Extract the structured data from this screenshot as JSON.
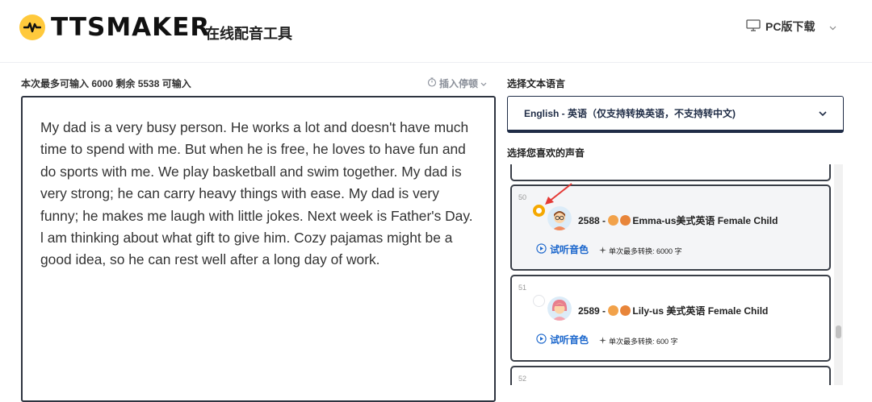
{
  "header": {
    "brand": "TTSMAKER",
    "subtitle": "在线配音工具",
    "pc_download": "PC版下载"
  },
  "editor": {
    "limit_label": "本次最多可输入 6000 剩余 5538 可输入",
    "insert_pause": "插入停顿",
    "text": "My dad is a very busy person. He works a lot and doesn't have much time to spend with me. But when he is free, he loves to have fun and do sports with me. We play basketball and swim together. My dad is very strong; he can carry heavy things with ease. My dad is very funny; he makes me laugh with little jokes. Next week is Father's Day. l am thinking about what gift to give him. Cozy pajamas might be a good idea, so he can rest well after a long day of work."
  },
  "language": {
    "title": "选择文本语言",
    "selected": "English - 英语（仅支持转换英语，不支持转中文)"
  },
  "voices": {
    "title": "选择您喜欢的声音",
    "items": [
      {
        "index": "50",
        "id_prefix": "2588 - ",
        "name": "Emma-us美式英语 Female Child",
        "listen": "试听音色",
        "limit": "单次最多转换: 6000 字",
        "selected": true
      },
      {
        "index": "51",
        "id_prefix": "2589 - ",
        "name": "Lily-us 美式英语 Female Child",
        "listen": "试听音色",
        "limit": "单次最多转换: 600 字",
        "selected": false
      },
      {
        "index": "52"
      }
    ]
  },
  "colors": {
    "accent": "#ffc93c",
    "radio_selected": "#f5a800",
    "link": "#1a66cc",
    "annotation_arrow": "#e53935"
  },
  "icons": [
    "logo-mark-icon",
    "monitor-icon",
    "chevron-down-icon",
    "timer-icon",
    "play-circle-icon",
    "sparkle-icon",
    "child-avatar-icon"
  ]
}
